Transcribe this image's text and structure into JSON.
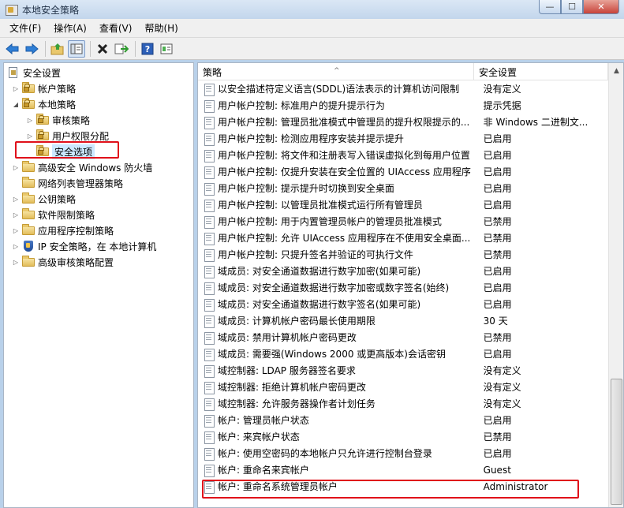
{
  "window": {
    "title": "本地安全策略",
    "controls": {
      "minimize": "—",
      "maximize": "☐",
      "close": "✕"
    }
  },
  "menu": [
    "文件(F)",
    "操作(A)",
    "查看(V)",
    "帮助(H)"
  ],
  "toolbar": {
    "buttons": [
      "back-icon",
      "forward-icon",
      "up-folder-icon",
      "show-tree-icon",
      "delete-icon",
      "export-icon",
      "help-icon",
      "properties-icon"
    ]
  },
  "tree": {
    "items": [
      {
        "label": "安全设置",
        "arrow": "",
        "icon": "doc-icon"
      },
      {
        "label": "帐户策略",
        "arrow": "▷",
        "icon": "folder-lock"
      },
      {
        "label": "本地策略",
        "arrow": "◢",
        "icon": "folder-lock"
      },
      {
        "label": "审核策略",
        "arrow": "▷",
        "icon": "folder-lock"
      },
      {
        "label": "用户权限分配",
        "arrow": "▷",
        "icon": "folder-lock"
      },
      {
        "label": "安全选项",
        "arrow": "",
        "icon": "folder-lock"
      },
      {
        "label": "高级安全 Windows 防火墙",
        "arrow": "▷",
        "icon": "folder"
      },
      {
        "label": "网络列表管理器策略",
        "arrow": "",
        "icon": "folder"
      },
      {
        "label": "公钥策略",
        "arrow": "▷",
        "icon": "folder"
      },
      {
        "label": "软件限制策略",
        "arrow": "▷",
        "icon": "folder"
      },
      {
        "label": "应用程序控制策略",
        "arrow": "▷",
        "icon": "folder"
      },
      {
        "label": "IP 安全策略，在 本地计算机",
        "arrow": "▷",
        "icon": "shield"
      },
      {
        "label": "高级审核策略配置",
        "arrow": "▷",
        "icon": "folder"
      }
    ]
  },
  "list": {
    "columns": {
      "policy": "策略",
      "setting": "安全设置"
    },
    "sort_caret": "^",
    "rows": [
      {
        "policy": "以安全描述符定义语言(SDDL)语法表示的计算机访问限制",
        "setting": "没有定义"
      },
      {
        "policy": "用户帐户控制: 标准用户的提升提示行为",
        "setting": "提示凭据"
      },
      {
        "policy": "用户帐户控制: 管理员批准模式中管理员的提升权限提示的...",
        "setting": "非 Windows 二进制文..."
      },
      {
        "policy": "用户帐户控制: 检测应用程序安装并提示提升",
        "setting": "已启用"
      },
      {
        "policy": "用户帐户控制: 将文件和注册表写入错误虚拟化到每用户位置",
        "setting": "已启用"
      },
      {
        "policy": "用户帐户控制: 仅提升安装在安全位置的 UIAccess 应用程序",
        "setting": "已启用"
      },
      {
        "policy": "用户帐户控制: 提示提升时切换到安全桌面",
        "setting": "已启用"
      },
      {
        "policy": "用户帐户控制: 以管理员批准模式运行所有管理员",
        "setting": "已启用"
      },
      {
        "policy": "用户帐户控制: 用于内置管理员帐户的管理员批准模式",
        "setting": "已禁用"
      },
      {
        "policy": "用户帐户控制: 允许 UIAccess 应用程序在不使用安全桌面...",
        "setting": "已禁用"
      },
      {
        "policy": "用户帐户控制: 只提升签名并验证的可执行文件",
        "setting": "已禁用"
      },
      {
        "policy": "域成员: 对安全通道数据进行数字加密(如果可能)",
        "setting": "已启用"
      },
      {
        "policy": "域成员: 对安全通道数据进行数字加密或数字签名(始终)",
        "setting": "已启用"
      },
      {
        "policy": "域成员: 对安全通道数据进行数字签名(如果可能)",
        "setting": "已启用"
      },
      {
        "policy": "域成员: 计算机帐户密码最长使用期限",
        "setting": "30 天"
      },
      {
        "policy": "域成员: 禁用计算机帐户密码更改",
        "setting": "已禁用"
      },
      {
        "policy": "域成员: 需要强(Windows 2000 或更高版本)会话密钥",
        "setting": "已启用"
      },
      {
        "policy": "域控制器: LDAP 服务器签名要求",
        "setting": "没有定义"
      },
      {
        "policy": "域控制器: 拒绝计算机帐户密码更改",
        "setting": "没有定义"
      },
      {
        "policy": "域控制器: 允许服务器操作者计划任务",
        "setting": "没有定义"
      },
      {
        "policy": "帐户: 管理员帐户状态",
        "setting": "已启用"
      },
      {
        "policy": "帐户: 来宾帐户状态",
        "setting": "已禁用"
      },
      {
        "policy": "帐户: 使用空密码的本地帐户只允许进行控制台登录",
        "setting": "已启用"
      },
      {
        "policy": "帐户: 重命名来宾帐户",
        "setting": "Guest"
      },
      {
        "policy": "帐户: 重命名系统管理员帐户",
        "setting": "Administrator"
      }
    ]
  },
  "colors": {
    "highlight_box": "#e0101a",
    "selection": "#cce8ff",
    "window_frame": "#b9d1ea"
  }
}
